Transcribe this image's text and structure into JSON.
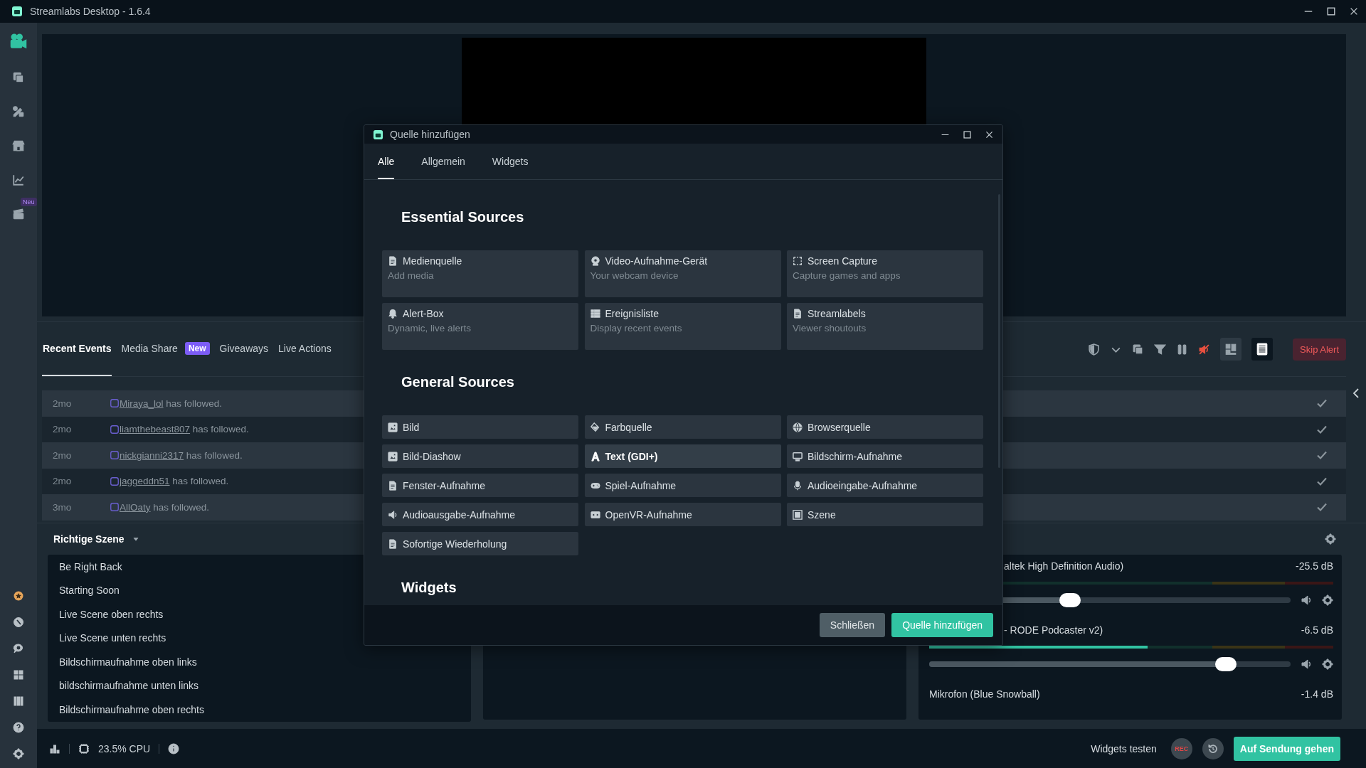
{
  "window": {
    "title": "Streamlabs Desktop - 1.6.4"
  },
  "nav": {
    "new_badge": "Neu"
  },
  "events": {
    "tabs": [
      {
        "label": "Recent Events",
        "selected": true
      },
      {
        "label": "Media Share",
        "selected": false,
        "badge": "New"
      },
      {
        "label": "Giveaways",
        "selected": false
      },
      {
        "label": "Live Actions",
        "selected": false
      }
    ],
    "skip_button": "Skip Alert",
    "rows": [
      {
        "time": "2mo",
        "user": "Miraya_lol",
        "action": "has followed."
      },
      {
        "time": "2mo",
        "user": "liamthebeast807",
        "action": "has followed."
      },
      {
        "time": "2mo",
        "user": "nickgianni2317",
        "action": "has followed."
      },
      {
        "time": "2mo",
        "user": "jaggeddn51",
        "action": "has followed."
      },
      {
        "time": "3mo",
        "user": "AllOaty",
        "action": "has followed."
      }
    ]
  },
  "scenes": {
    "title": "Richtige Szene",
    "items": [
      "Be Right Back",
      "Starting Soon",
      "Live Scene oben rechts",
      "Live Scene unten rechts",
      "Bildschirmaufnahme oben links",
      "bildschirmaufnahme unten links",
      "Bildschirmaufnahme oben rechts"
    ]
  },
  "mixer": {
    "items": [
      {
        "name": "altek High Definition Audio)",
        "reading": "-25.5 dB",
        "volume": {
          "level": 0.39
        }
      },
      {
        "name": "- RODE Podcaster v2)",
        "reading": "-6.5 dB",
        "meter": {
          "level": 0.54
        },
        "volume": {
          "level": 0.82
        }
      },
      {
        "name": "Mikrofon (Blue Snowball)",
        "reading": "-1.4 dB"
      }
    ]
  },
  "footer": {
    "cpu": "23.5% CPU",
    "test_widgets": "Widgets testen",
    "rec": "REC",
    "go_live": "Auf Sendung gehen"
  },
  "dialog": {
    "title": "Quelle hinzufügen",
    "tabs": [
      {
        "label": "Alle",
        "selected": true
      },
      {
        "label": "Allgemein",
        "selected": false
      },
      {
        "label": "Widgets",
        "selected": false
      }
    ],
    "sections": [
      {
        "heading": "Essential Sources",
        "kind": "described",
        "items": [
          {
            "name": "Medienquelle",
            "description": "Add media"
          },
          {
            "name": "Video-Aufnahme-Gerät",
            "description": "Your webcam device"
          },
          {
            "name": "Screen Capture",
            "description": "Capture games and apps"
          },
          {
            "name": "Alert-Box",
            "description": "Dynamic, live alerts"
          },
          {
            "name": "Ereignisliste",
            "description": "Display recent events"
          },
          {
            "name": "Streamlabels",
            "description": "Viewer shoutouts"
          }
        ]
      },
      {
        "heading": "General Sources",
        "kind": "compact",
        "items": [
          {
            "name": "Bild",
            "highlighted": false
          },
          {
            "name": "Farbquelle",
            "highlighted": false
          },
          {
            "name": "Browserquelle",
            "highlighted": false
          },
          {
            "name": "Bild-Diashow",
            "highlighted": false
          },
          {
            "name": "Text (GDI+)",
            "highlighted": true
          },
          {
            "name": "Bildschirm-Aufnahme",
            "highlighted": false
          },
          {
            "name": "Fenster-Aufnahme",
            "highlighted": false
          },
          {
            "name": "Spiel-Aufnahme",
            "highlighted": false
          },
          {
            "name": "Audioeingabe-Aufnahme",
            "highlighted": false
          },
          {
            "name": "Audioausgabe-Aufnahme",
            "highlighted": false
          },
          {
            "name": "OpenVR-Aufnahme",
            "highlighted": false
          },
          {
            "name": "Szene",
            "highlighted": false
          },
          {
            "name": "Sofortige Wiederholung",
            "highlighted": false
          }
        ]
      },
      {
        "heading": "Widgets"
      }
    ],
    "buttons": [
      {
        "label": "Schließen",
        "kind": "secondary"
      },
      {
        "label": "Quelle hinzufügen",
        "kind": "primary"
      }
    ]
  }
}
